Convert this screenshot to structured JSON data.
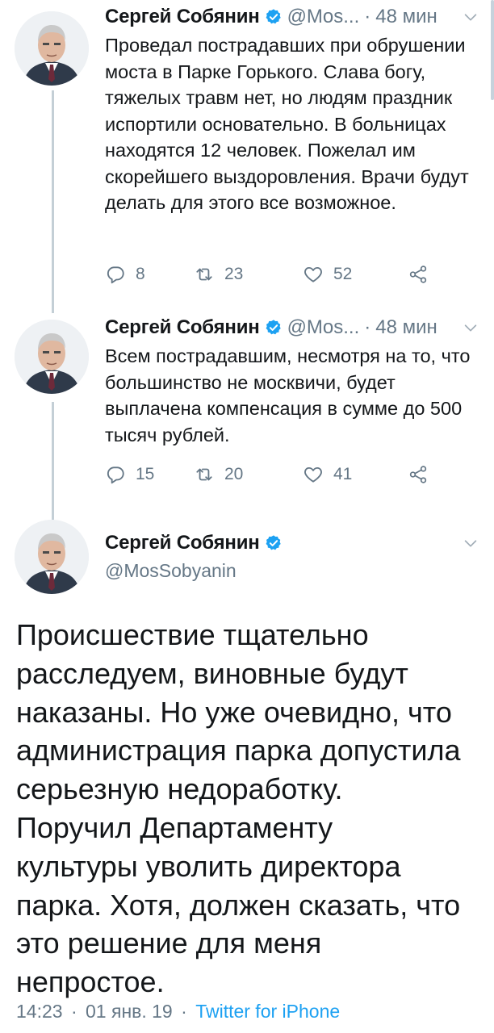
{
  "colors": {
    "accent": "#1da1f2",
    "muted": "#657786",
    "text": "#14171a",
    "thread": "#c4cfd6"
  },
  "tweets": [
    {
      "name": "Сергей Собянин",
      "handle": "@Mos...",
      "sep": "·",
      "time": "48 мин",
      "text": "Проведал пострадавших при обрушении моста в Парке Горького. Слава богу, тяжелых травм нет, но людям праздник испортили основательно. В больницах находятся 12 человек. Пожелал им скорейшего выздоровления. Врачи будут делать для этого все возможное.",
      "replies": "8",
      "retweets": "23",
      "likes": "52"
    },
    {
      "name": "Сергей Собянин",
      "handle": "@Mos...",
      "sep": "·",
      "time": "48 мин",
      "text": "Всем пострадавшим, несмотря на то, что большинство не москвичи, будет выплачена компенсация в сумме до 500 тысяч рублей.",
      "replies": "15",
      "retweets": "20",
      "likes": "41"
    }
  ],
  "main": {
    "name": "Сергей Собянин",
    "handle": "@MosSobyanin",
    "text": "Происшествие тщательно расследуем, виновные будут наказаны. Но уже очевидно, что администрация парка допустила серьезную недоработку. Поручил Департаменту культуры уволить директора парка. Хотя, должен сказать, что это решение для меня непростое.",
    "time": "14:23",
    "sep": "·",
    "date": "01 янв. 19",
    "source": "Twitter for iPhone"
  },
  "icons": {
    "verified": "verified-badge-icon",
    "chevron": "chevron-down-icon",
    "reply": "reply-icon",
    "retweet": "retweet-icon",
    "like": "heart-icon",
    "share": "share-icon"
  }
}
